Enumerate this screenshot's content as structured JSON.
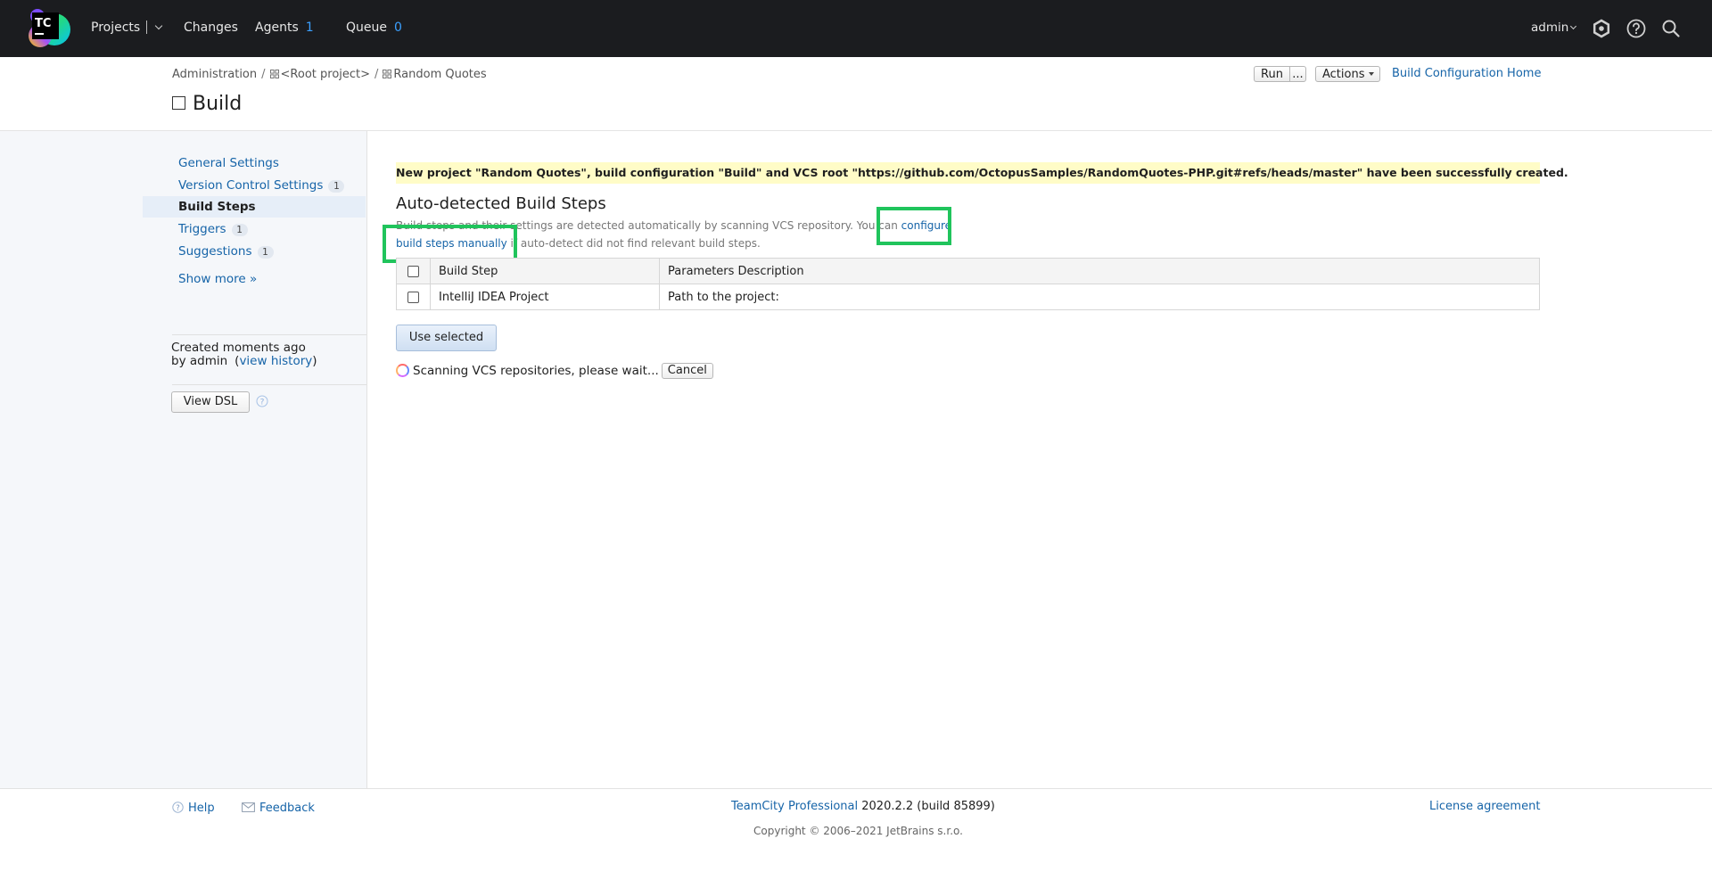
{
  "nav": {
    "logo_text": "TC",
    "projects": "Projects",
    "changes": "Changes",
    "agents": "Agents",
    "agents_count": "1",
    "queue": "Queue",
    "queue_count": "0",
    "user": "admin"
  },
  "header": {
    "breadcrumb": [
      "Administration",
      "<Root project>",
      "Random Quotes"
    ],
    "breadcrumb_sep": "/",
    "title": "Build",
    "run": "Run",
    "more": "...",
    "actions": "Actions",
    "home_link": "Build Configuration Home"
  },
  "sidebar": {
    "items": [
      {
        "label": "General Settings",
        "badge": ""
      },
      {
        "label": "Version Control Settings",
        "badge": "1"
      },
      {
        "label": "Build Steps",
        "badge": ""
      },
      {
        "label": "Triggers",
        "badge": "1"
      },
      {
        "label": "Suggestions",
        "badge": "1"
      }
    ],
    "show_more": "Show more »",
    "created": "Created moments ago",
    "by": "by admin",
    "view_history": "view history",
    "view_dsl": "View DSL"
  },
  "main": {
    "notice": "New project \"Random Quotes\", build configuration \"Build\" and VCS root \"https://github.com/OctopusSamples/RandomQuotes-PHP.git#refs/heads/master\" have been successfully created.",
    "section_title": "Auto-detected Build Steps",
    "desc_before": "Build steps and their settings are detected automatically by scanning VCS repository. You can ",
    "desc_link": "configure build steps manually",
    "desc_after": " if auto-detect did not find relevant build steps.",
    "table": {
      "headers": [
        "Build Step",
        "Parameters Description"
      ],
      "rows": [
        {
          "step": "IntelliJ IDEA Project",
          "params": "Path to the project:"
        }
      ]
    },
    "use_selected": "Use selected",
    "scanning": "Scanning VCS repositories, please wait...",
    "cancel": "Cancel"
  },
  "footer": {
    "help": "Help",
    "feedback": "Feedback",
    "product": "TeamCity Professional",
    "version": "2020.2.2 (build 85899)",
    "license": "License agreement",
    "copyright": "Copyright © 2006–2021 JetBrains s.r.o."
  },
  "colors": {
    "topbar": "#1b1c1f",
    "link": "#1664a8",
    "notice_bg": "#fffcc7",
    "highlight_box": "#20c45c",
    "count": "#3ba0ff"
  }
}
